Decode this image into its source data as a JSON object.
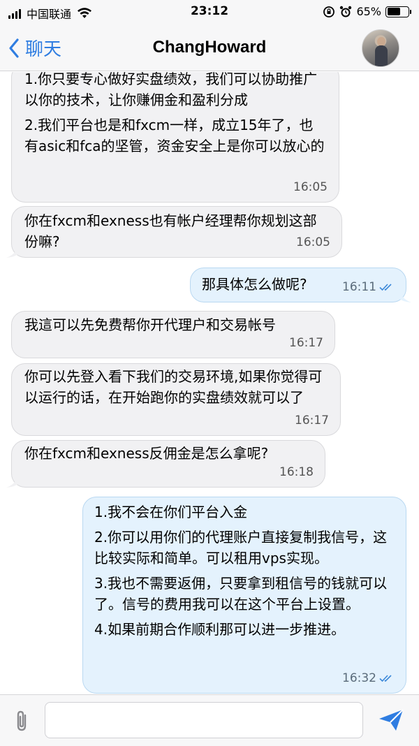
{
  "status_bar": {
    "carrier": "中国联通",
    "time": "23:12",
    "battery": "65%",
    "battery_level": 0.65
  },
  "nav": {
    "back_label": "聊天",
    "title": "ChangHoward"
  },
  "messages": [
    {
      "direction": "in",
      "paragraphs": [
        "1.你只要专心做好实盘绩效，我们可以协助推广以你的技术，让你赚佣金和盈利分成",
        "2.我们平台也是和fxcm一样，成立15年了，也有asic和fca的坚管，资金安全上是你可以放心的"
      ],
      "time": "16:05"
    },
    {
      "direction": "in",
      "paragraphs": [
        "你在fxcm和exness也有帐户经理帮你规划这部份嘛?"
      ],
      "time": "16:05"
    },
    {
      "direction": "out",
      "paragraphs": [
        "那具体怎么做呢?"
      ],
      "time": "16:11",
      "status": "read"
    },
    {
      "direction": "in",
      "paragraphs": [
        "我這可以先免费帮你开代理户和交易帐号"
      ],
      "time": "16:17"
    },
    {
      "direction": "in",
      "paragraphs": [
        "你可以先登入看下我们的交易环境,如果你觉得可以运行的话，在开始跑你的实盘绩效就可以了"
      ],
      "time": "16:17"
    },
    {
      "direction": "in",
      "paragraphs": [
        "你在fxcm和exness反佣金是怎么拿呢?"
      ],
      "time": "16:18"
    },
    {
      "direction": "out",
      "paragraphs": [
        "1.我不会在你们平台入金",
        "2.你可以用你们的代理账户直接复制我信号，这比较实际和简单。可以租用vps实现。",
        "3.我也不需要返佣，只要拿到租信号的钱就可以了。信号的费用我可以在这个平台上设置。",
        "4.如果前期合作顺利那可以进一步推进。"
      ],
      "time": "16:32",
      "status": "read"
    }
  ],
  "input": {
    "value": "",
    "placeholder": ""
  },
  "icons": {
    "back": "chevron-left-icon",
    "attach": "paperclip-icon",
    "send": "send-icon",
    "read_status": "double-check-icon"
  },
  "colors": {
    "accent": "#2f7de1",
    "incoming_bubble": "#f1f1f3",
    "outgoing_bubble": "#e4f2fd"
  }
}
